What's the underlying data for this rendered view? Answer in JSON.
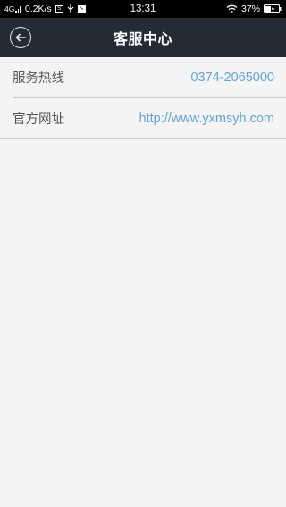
{
  "status_bar": {
    "network": "4G",
    "speed": "0.2K/s",
    "time": "13:31",
    "battery": "37%"
  },
  "header": {
    "title": "客服中心",
    "back_icon": "back-arrow-icon"
  },
  "rows": [
    {
      "label": "服务热线",
      "value": "0374-2065000"
    },
    {
      "label": "官方网址",
      "value": "http://www.yxmsyh.com"
    }
  ],
  "colors": {
    "nav_background": "#252b35",
    "link": "#63a3dc",
    "page_background": "#f4f4f4"
  }
}
